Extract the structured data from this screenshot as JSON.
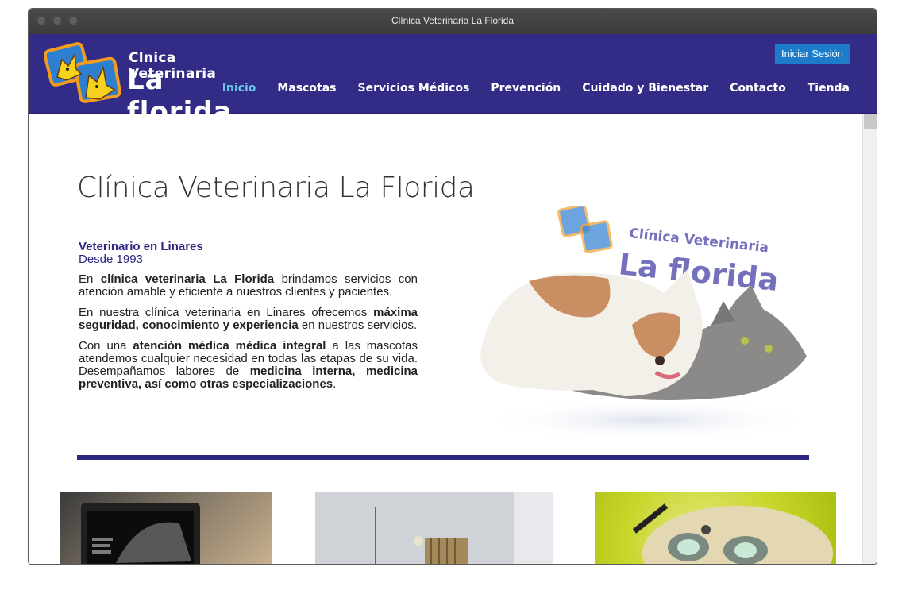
{
  "window": {
    "title": "Clínica Veterinaria La Florida"
  },
  "header": {
    "logo_top": "Clnica Veterinaria",
    "logo_bottom": "La florida",
    "login_label": "Iniciar Sesión",
    "nav": [
      {
        "label": "Inicio",
        "active": true
      },
      {
        "label": "Mascotas"
      },
      {
        "label": "Servicios Médicos"
      },
      {
        "label": "Prevención"
      },
      {
        "label": "Cuidado y Bienestar"
      },
      {
        "label": "Contacto"
      },
      {
        "label": "Tienda"
      }
    ],
    "colors": {
      "header_bg": "#332c86",
      "active_link": "#69c3e6",
      "login_bg": "#1c7cc9"
    }
  },
  "main": {
    "title": "Clínica Veterinaria La Florida",
    "subhead_1": "Veterinario en Linares",
    "subhead_2": "Desde 1993",
    "p1_a": "En ",
    "p1_b": "clínica veterinaria La Florida",
    "p1_c": " brindamos servicios con atención amable y eficiente a nuestros clientes y pacientes.",
    "p2_a": "En nuestra clínica veterinaria en Linares ofrecemos ",
    "p2_b": "máxima seguridad, conocimiento y experiencia",
    "p2_c": " en nuestros servicios.",
    "p3_a": "Con una ",
    "p3_b": "atención médica médica integral",
    "p3_c": " a las mascotas atendemos cualquier necesidad en todas las etapas de su vida. Desempañamos labores de ",
    "p3_d": "medicina interna, medicina preventiva, así como otras especializaciones",
    "p3_e": ".",
    "hero_logo_top": "Clínica Veterinaria",
    "hero_logo_bottom": "La florida"
  }
}
